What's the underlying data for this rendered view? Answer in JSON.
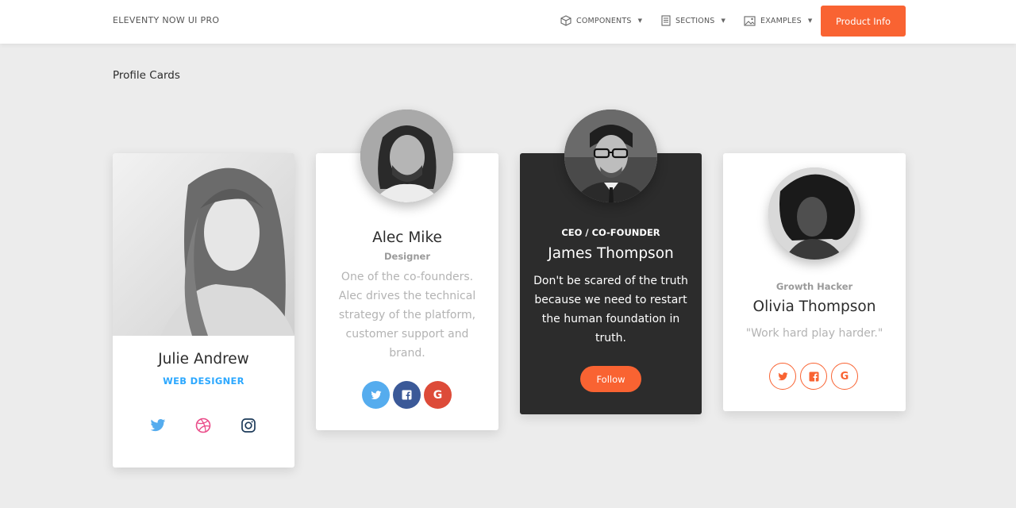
{
  "nav": {
    "brand": "ELEVENTY NOW UI PRO",
    "items": [
      {
        "label": "COMPONENTS",
        "icon": "box-icon"
      },
      {
        "label": "SECTIONS",
        "icon": "document-icon"
      },
      {
        "label": "EXAMPLES",
        "icon": "image-icon"
      }
    ],
    "cta": "Product Info"
  },
  "section_title": "Profile Cards",
  "cards": [
    {
      "name": "Julie Andrew",
      "role": "WEB DESIGNER",
      "social": [
        "twitter-icon",
        "dribbble-icon",
        "instagram-icon"
      ]
    },
    {
      "name": "Alec Mike",
      "role": "Designer",
      "description": "One of the co-founders. Alec drives the technical strategy of the platform, customer support and brand.",
      "social": [
        "twitter-icon",
        "facebook-icon",
        "google-icon"
      ]
    },
    {
      "role": "CEO / CO-FOUNDER",
      "name": "James Thompson",
      "description": "Don't be scared of the truth because we need to restart the human foundation in truth.",
      "button": "Follow"
    },
    {
      "role": "Growth Hacker",
      "name": "Olivia Thompson",
      "quote": "\"Work hard play harder.\"",
      "social": [
        "twitter-icon",
        "facebook-icon",
        "google-icon"
      ]
    }
  ],
  "colors": {
    "accent": "#f96332",
    "blue": "#2ca8ff",
    "twitter": "#55acee",
    "facebook": "#3b5998",
    "google": "#dd4b39",
    "dribbble": "#ea4c89",
    "dark_card": "#2c2c2c"
  }
}
